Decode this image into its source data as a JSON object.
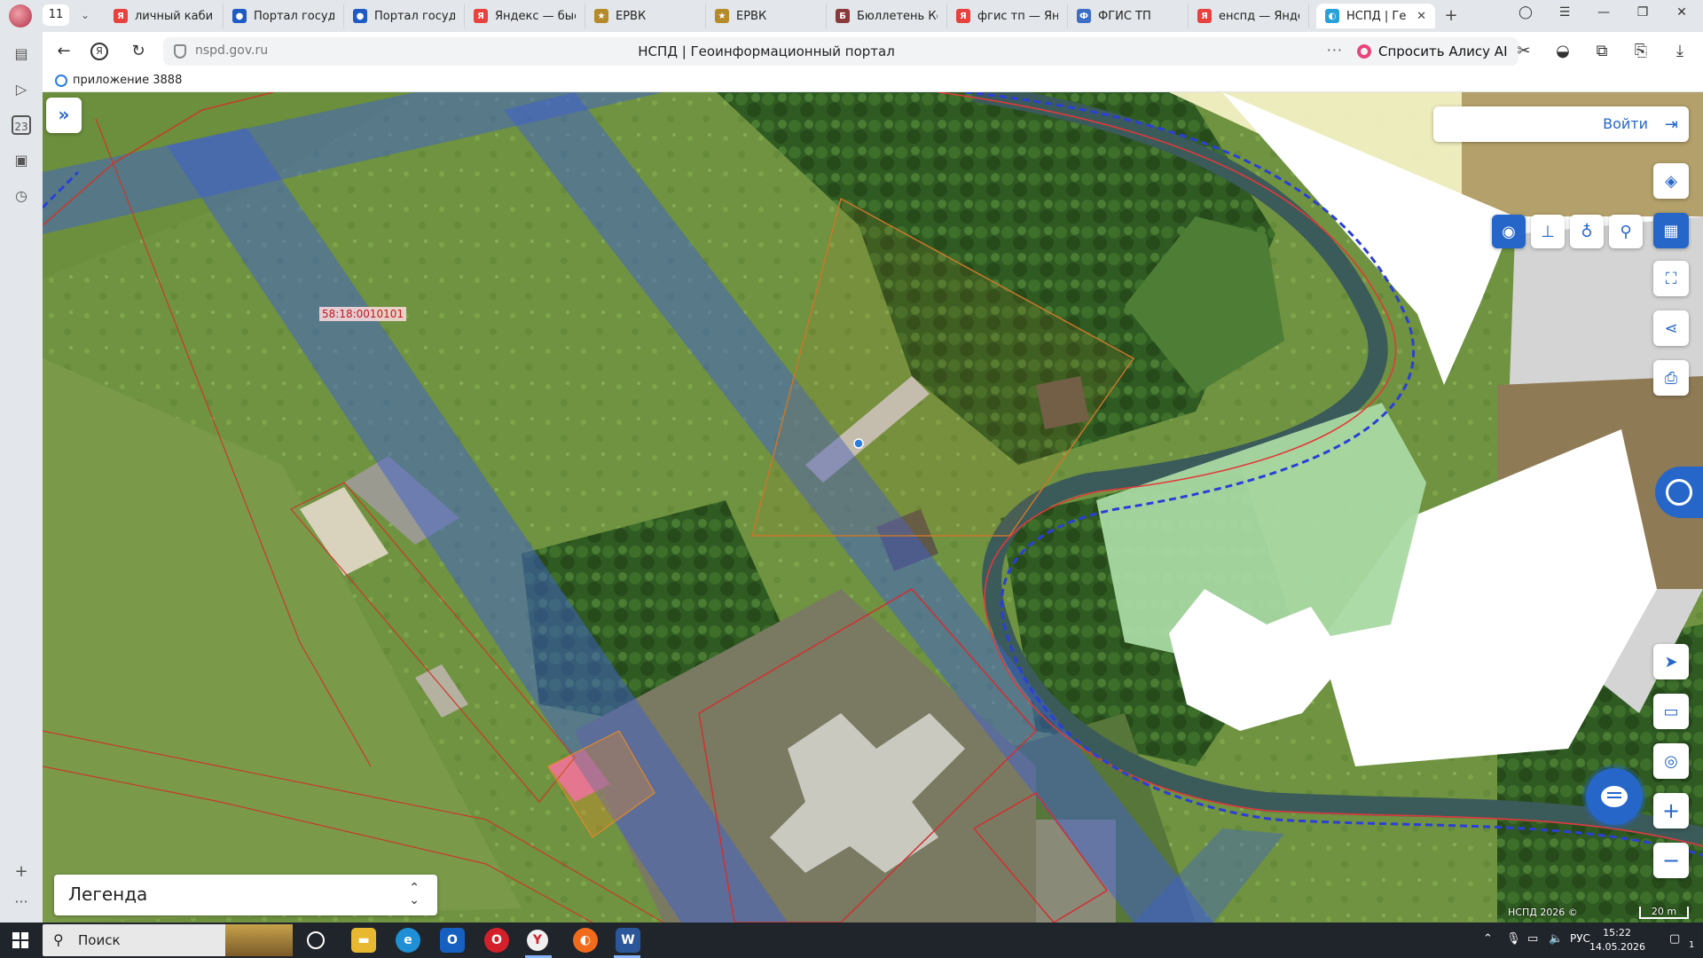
{
  "browser": {
    "tab_count": "11",
    "tabs": [
      {
        "label": "личный кабинет",
        "favicon": "Я",
        "color": "#e8413e"
      },
      {
        "label": "Портал государственных услуг",
        "favicon": "●",
        "color": "#1e5bc6"
      },
      {
        "label": "Портал государственных услуг",
        "favicon": "●",
        "color": "#1e5bc6"
      },
      {
        "label": "Яндекс — быстрый поиск",
        "favicon": "Я",
        "color": "#e8413e"
      },
      {
        "label": "ЕРВК",
        "favicon": "★",
        "color": "#b58b2a"
      },
      {
        "label": "ЕРВК",
        "favicon": "★",
        "color": "#b58b2a"
      },
      {
        "label": "Бюллетень Конкурсов",
        "favicon": "Б",
        "color": "#8a3a3a"
      },
      {
        "label": "фгис тп — Яндекс",
        "favicon": "Я",
        "color": "#e8413e"
      },
      {
        "label": "ФГИС ТП",
        "favicon": "Ф",
        "color": "#3d6fc6"
      },
      {
        "label": "енспд — Яндекс",
        "favicon": "Я",
        "color": "#e8413e"
      },
      {
        "label": "НСПД | Геоинформационный портал",
        "favicon": "◐",
        "color": "#2aa0d8"
      }
    ],
    "url": "nspd.gov.ru",
    "page_title": "НСПД | Геоинформационный портал",
    "alice_label": "Спросить Алису AI",
    "bookmark_label": "приложение 3888"
  },
  "map": {
    "login_label": "Войти",
    "parcel_label": "58:18:0010101",
    "legend_label": "Легенда",
    "attribution": "НСПД 2026 ©",
    "scale_label": "20 m"
  },
  "taskbar": {
    "search_placeholder": "Поиск",
    "language": "РУС",
    "time": "15:22",
    "date": "14.05.2026",
    "notification_count": "1"
  }
}
